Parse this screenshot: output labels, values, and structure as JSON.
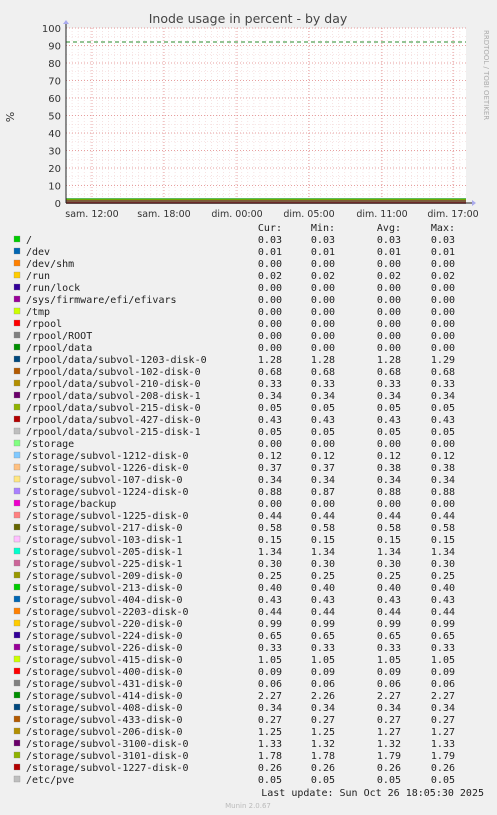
{
  "chart_data": {
    "type": "line",
    "title": "Inode usage in percent - by day",
    "ylabel": "%",
    "ylim": [
      0,
      100
    ],
    "yticks": [
      0,
      10,
      20,
      30,
      40,
      50,
      60,
      70,
      80,
      90,
      100
    ],
    "xticks": [
      "sam. 12:00",
      "sam. 18:00",
      "dim. 00:00",
      "dim. 05:00",
      "dim. 11:00",
      "dim. 17:00"
    ],
    "grid": true,
    "warning_line": 92,
    "watermark": "RRDTOOL / TOBI OETIKER",
    "columns": [
      "Cur:",
      "Min:",
      "Avg:",
      "Max:"
    ],
    "series": [
      {
        "name": "/",
        "color": "#00cc00",
        "cur": "0.03",
        "min": "0.03",
        "avg": "0.03",
        "max": "0.03"
      },
      {
        "name": "/dev",
        "color": "#0066b3",
        "cur": "0.01",
        "min": "0.01",
        "avg": "0.01",
        "max": "0.01"
      },
      {
        "name": "/dev/shm",
        "color": "#ff8000",
        "cur": "0.00",
        "min": "0.00",
        "avg": "0.00",
        "max": "0.00"
      },
      {
        "name": "/run",
        "color": "#ffcc00",
        "cur": "0.02",
        "min": "0.02",
        "avg": "0.02",
        "max": "0.02"
      },
      {
        "name": "/run/lock",
        "color": "#330099",
        "cur": "0.00",
        "min": "0.00",
        "avg": "0.00",
        "max": "0.00"
      },
      {
        "name": "/sys/firmware/efi/efivars",
        "color": "#990099",
        "cur": "0.00",
        "min": "0.00",
        "avg": "0.00",
        "max": "0.00"
      },
      {
        "name": "/tmp",
        "color": "#ccff00",
        "cur": "0.00",
        "min": "0.00",
        "avg": "0.00",
        "max": "0.00"
      },
      {
        "name": "/rpool",
        "color": "#ff0000",
        "cur": "0.00",
        "min": "0.00",
        "avg": "0.00",
        "max": "0.00"
      },
      {
        "name": "/rpool/ROOT",
        "color": "#808080",
        "cur": "0.00",
        "min": "0.00",
        "avg": "0.00",
        "max": "0.00"
      },
      {
        "name": "/rpool/data",
        "color": "#008f00",
        "cur": "0.00",
        "min": "0.00",
        "avg": "0.00",
        "max": "0.00"
      },
      {
        "name": "/rpool/data/subvol-1203-disk-0",
        "color": "#00487d",
        "cur": "1.28",
        "min": "1.28",
        "avg": "1.28",
        "max": "1.29"
      },
      {
        "name": "/rpool/data/subvol-102-disk-0",
        "color": "#b35a00",
        "cur": "0.68",
        "min": "0.68",
        "avg": "0.68",
        "max": "0.68"
      },
      {
        "name": "/rpool/data/subvol-210-disk-0",
        "color": "#b38f00",
        "cur": "0.33",
        "min": "0.33",
        "avg": "0.33",
        "max": "0.33"
      },
      {
        "name": "/rpool/data/subvol-208-disk-1",
        "color": "#6b006b",
        "cur": "0.34",
        "min": "0.34",
        "avg": "0.34",
        "max": "0.34"
      },
      {
        "name": "/rpool/data/subvol-215-disk-0",
        "color": "#8fb300",
        "cur": "0.05",
        "min": "0.05",
        "avg": "0.05",
        "max": "0.05"
      },
      {
        "name": "/rpool/data/subvol-427-disk-0",
        "color": "#b30000",
        "cur": "0.43",
        "min": "0.43",
        "avg": "0.43",
        "max": "0.43"
      },
      {
        "name": "/rpool/data/subvol-215-disk-1",
        "color": "#bebebe",
        "cur": "0.05",
        "min": "0.05",
        "avg": "0.05",
        "max": "0.05"
      },
      {
        "name": "/storage",
        "color": "#80ff80",
        "cur": "0.00",
        "min": "0.00",
        "avg": "0.00",
        "max": "0.00"
      },
      {
        "name": "/storage/subvol-1212-disk-0",
        "color": "#80c9ff",
        "cur": "0.12",
        "min": "0.12",
        "avg": "0.12",
        "max": "0.12"
      },
      {
        "name": "/storage/subvol-1226-disk-0",
        "color": "#ffc080",
        "cur": "0.37",
        "min": "0.37",
        "avg": "0.38",
        "max": "0.38"
      },
      {
        "name": "/storage/subvol-107-disk-0",
        "color": "#ffe680",
        "cur": "0.34",
        "min": "0.34",
        "avg": "0.34",
        "max": "0.34"
      },
      {
        "name": "/storage/subvol-1224-disk-0",
        "color": "#aa80ff",
        "cur": "0.88",
        "min": "0.87",
        "avg": "0.88",
        "max": "0.88"
      },
      {
        "name": "/storage/backup",
        "color": "#ee00cc",
        "cur": "0.00",
        "min": "0.00",
        "avg": "0.00",
        "max": "0.00"
      },
      {
        "name": "/storage/subvol-1225-disk-0",
        "color": "#ff8080",
        "cur": "0.44",
        "min": "0.44",
        "avg": "0.44",
        "max": "0.44"
      },
      {
        "name": "/storage/subvol-217-disk-0",
        "color": "#666600",
        "cur": "0.58",
        "min": "0.58",
        "avg": "0.58",
        "max": "0.58"
      },
      {
        "name": "/storage/subvol-103-disk-1",
        "color": "#ffbfff",
        "cur": "0.15",
        "min": "0.15",
        "avg": "0.15",
        "max": "0.15"
      },
      {
        "name": "/storage/subvol-205-disk-1",
        "color": "#00ffcc",
        "cur": "1.34",
        "min": "1.34",
        "avg": "1.34",
        "max": "1.34"
      },
      {
        "name": "/storage/subvol-225-disk-1",
        "color": "#cc6699",
        "cur": "0.30",
        "min": "0.30",
        "avg": "0.30",
        "max": "0.30"
      },
      {
        "name": "/storage/subvol-209-disk-0",
        "color": "#999900",
        "cur": "0.25",
        "min": "0.25",
        "avg": "0.25",
        "max": "0.25"
      },
      {
        "name": "/storage/subvol-213-disk-0",
        "color": "#00cc00",
        "cur": "0.40",
        "min": "0.40",
        "avg": "0.40",
        "max": "0.40"
      },
      {
        "name": "/storage/subvol-404-disk-0",
        "color": "#0066b3",
        "cur": "0.43",
        "min": "0.43",
        "avg": "0.43",
        "max": "0.43"
      },
      {
        "name": "/storage/subvol-2203-disk-0",
        "color": "#ff8000",
        "cur": "0.44",
        "min": "0.44",
        "avg": "0.44",
        "max": "0.44"
      },
      {
        "name": "/storage/subvol-220-disk-0",
        "color": "#ffcc00",
        "cur": "0.99",
        "min": "0.99",
        "avg": "0.99",
        "max": "0.99"
      },
      {
        "name": "/storage/subvol-224-disk-0",
        "color": "#330099",
        "cur": "0.65",
        "min": "0.65",
        "avg": "0.65",
        "max": "0.65"
      },
      {
        "name": "/storage/subvol-226-disk-0",
        "color": "#990099",
        "cur": "0.33",
        "min": "0.33",
        "avg": "0.33",
        "max": "0.33"
      },
      {
        "name": "/storage/subvol-415-disk-0",
        "color": "#ccff00",
        "cur": "1.05",
        "min": "1.05",
        "avg": "1.05",
        "max": "1.05"
      },
      {
        "name": "/storage/subvol-400-disk-0",
        "color": "#ff0000",
        "cur": "0.09",
        "min": "0.09",
        "avg": "0.09",
        "max": "0.09"
      },
      {
        "name": "/storage/subvol-431-disk-0",
        "color": "#808080",
        "cur": "0.06",
        "min": "0.06",
        "avg": "0.06",
        "max": "0.06"
      },
      {
        "name": "/storage/subvol-414-disk-0",
        "color": "#008f00",
        "cur": "2.27",
        "min": "2.26",
        "avg": "2.27",
        "max": "2.27"
      },
      {
        "name": "/storage/subvol-408-disk-0",
        "color": "#00487d",
        "cur": "0.34",
        "min": "0.34",
        "avg": "0.34",
        "max": "0.34"
      },
      {
        "name": "/storage/subvol-433-disk-0",
        "color": "#b35a00",
        "cur": "0.27",
        "min": "0.27",
        "avg": "0.27",
        "max": "0.27"
      },
      {
        "name": "/storage/subvol-206-disk-0",
        "color": "#b38f00",
        "cur": "1.25",
        "min": "1.25",
        "avg": "1.27",
        "max": "1.27"
      },
      {
        "name": "/storage/subvol-3100-disk-0",
        "color": "#6b006b",
        "cur": "1.33",
        "min": "1.32",
        "avg": "1.32",
        "max": "1.33"
      },
      {
        "name": "/storage/subvol-3101-disk-0",
        "color": "#8fb300",
        "cur": "1.78",
        "min": "1.78",
        "avg": "1.79",
        "max": "1.79"
      },
      {
        "name": "/storage/subvol-1227-disk-0",
        "color": "#b30000",
        "cur": "0.26",
        "min": "0.26",
        "avg": "0.26",
        "max": "0.26"
      },
      {
        "name": "/etc/pve",
        "color": "#bebebe",
        "cur": "0.05",
        "min": "0.05",
        "avg": "0.05",
        "max": "0.05"
      }
    ]
  },
  "last_update": "Last update: Sun Oct 26 18:05:30 2025",
  "footer": "Munin 2.0.67"
}
